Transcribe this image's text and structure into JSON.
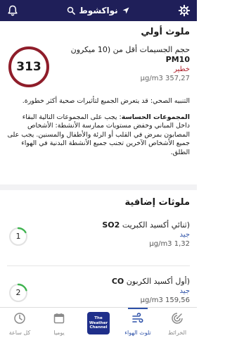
{
  "header": {
    "location": "نواكشوط",
    "left_icon": "bell-icon",
    "right_icon": "gear-icon",
    "location_icon": "location-arrow-icon",
    "search_icon": "search-icon",
    "bar_color": "#1f1f59"
  },
  "primary": {
    "title": "ملوث أولي",
    "value": "313",
    "pollutant_code": "PM10",
    "pollutant_desc": "حجم الجسيمات أقل من (10 ميكرون",
    "status": "خطير",
    "concentration": "357,27 µg/m3",
    "status_color": "#b0202b",
    "advisory": "التنبيه الصحي: قد يتعرض الجميع لتأثيرات صحية أكثر خطورة.",
    "sensitive_label": "المجموعات الحساسة",
    "sensitive_text": ": يجب على المجموعات التالية البقاء داخل المباني وخفض مستويات ممارسة الأنشطة: الأشخاص المصابون بمرض في القلب أو الرئة والأطفال والمسنين. يجب على جميع الأشخاص الآخرين تجنب جميع الأنشطة البدنية في الهواء الطلق."
  },
  "additional": {
    "title": "ملوثات إضافية",
    "items": [
      {
        "code": "SO2",
        "desc": "(ثنائي أكسيد الكبريت",
        "status": "جيد",
        "concentration": "1,32 µg/m3",
        "value": "1",
        "ring_color": "#3fb34f"
      },
      {
        "code": "CO",
        "desc": "(أول أكسيد الكربون",
        "status": "جيد",
        "concentration": "159,56 µg/m3",
        "value": "2",
        "ring_color": "#3fb34f"
      }
    ]
  },
  "nav": {
    "items": [
      {
        "label": "كل ساعة",
        "icon": "clock-icon"
      },
      {
        "label": "يوميا",
        "icon": "calendar-icon"
      },
      {
        "label": "The Weather Channel",
        "icon": "weather-channel-logo"
      },
      {
        "label": "تلوث الهواء",
        "icon": "air-quality-icon",
        "active": true
      },
      {
        "label": "الخرائط",
        "icon": "radar-map-icon"
      }
    ],
    "logo_lines": [
      "The",
      "Weather",
      "Channel"
    ],
    "active_color": "#2d51a8"
  }
}
